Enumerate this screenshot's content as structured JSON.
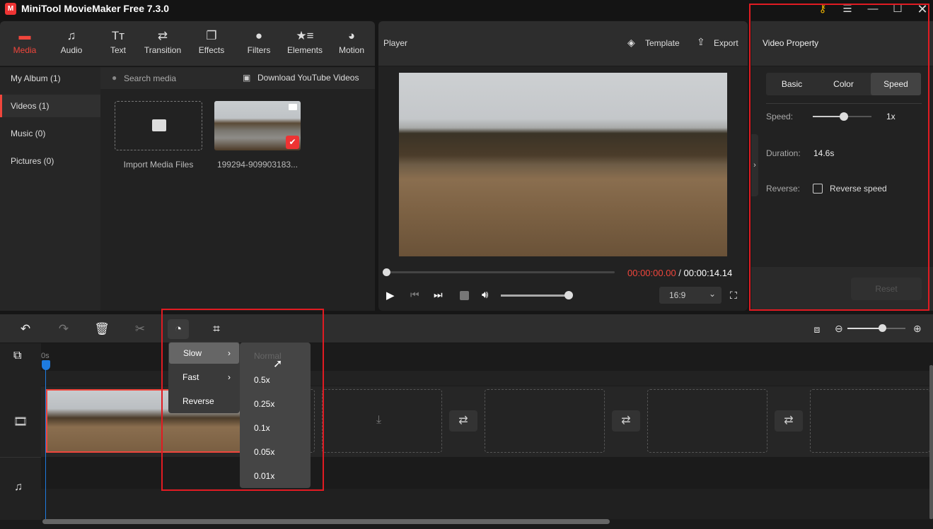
{
  "app": {
    "title": "MiniTool MovieMaker Free 7.3.0"
  },
  "window_controls": [
    "key-icon",
    "menu-icon",
    "minimize-icon",
    "maximize-icon",
    "close-icon"
  ],
  "tabs": [
    {
      "label": "Media",
      "icon": "folder-icon",
      "active": true
    },
    {
      "label": "Audio",
      "icon": "music-icon"
    },
    {
      "label": "Text",
      "icon": "text-icon"
    },
    {
      "label": "Transition",
      "icon": "transition-icon"
    },
    {
      "label": "Effects",
      "icon": "effects-icon"
    },
    {
      "label": "Filters",
      "icon": "filters-icon"
    },
    {
      "label": "Elements",
      "icon": "elements-icon"
    },
    {
      "label": "Motion",
      "icon": "motion-icon"
    }
  ],
  "sidebar": {
    "items": [
      {
        "label": "My Album (1)"
      },
      {
        "label": "Videos (1)",
        "active": true
      },
      {
        "label": "Music (0)"
      },
      {
        "label": "Pictures (0)"
      }
    ]
  },
  "media": {
    "search_placeholder": "Search media",
    "download_label": "Download YouTube Videos",
    "import_label": "Import Media Files",
    "file_name": "199294-909903183..."
  },
  "player": {
    "title": "Player",
    "template_label": "Template",
    "export_label": "Export",
    "current_time": "00:00:00.00",
    "separator": " / ",
    "total_time": "00:00:14.14",
    "progress": 0,
    "volume": 1.0,
    "aspect_ratio": "16:9"
  },
  "property": {
    "title": "Video Property",
    "tabs": [
      "Basic",
      "Color",
      "Speed"
    ],
    "active_tab": "Speed",
    "speed_label": "Speed:",
    "speed_value": "1x",
    "duration_label": "Duration:",
    "duration_value": "14.6s",
    "reverse_label": "Reverse:",
    "reverse_checkbox": "Reverse speed",
    "reverse_checked": false,
    "reset_label": "Reset"
  },
  "timeline": {
    "ruler_start": "0s",
    "zoom_level": 0.6
  },
  "speed_menu": {
    "items": [
      {
        "label": "Slow",
        "submenu": true,
        "highlighted": true
      },
      {
        "label": "Fast",
        "submenu": true
      },
      {
        "label": "Reverse"
      }
    ],
    "submenu": [
      {
        "label": "Normal",
        "disabled": true
      },
      {
        "label": "0.5x"
      },
      {
        "label": "0.25x"
      },
      {
        "label": "0.1x"
      },
      {
        "label": "0.05x"
      },
      {
        "label": "0.01x"
      }
    ]
  },
  "colors": {
    "accent": "#f0463c",
    "highlight_box": "#e11b22",
    "playhead": "#1e7be0"
  }
}
